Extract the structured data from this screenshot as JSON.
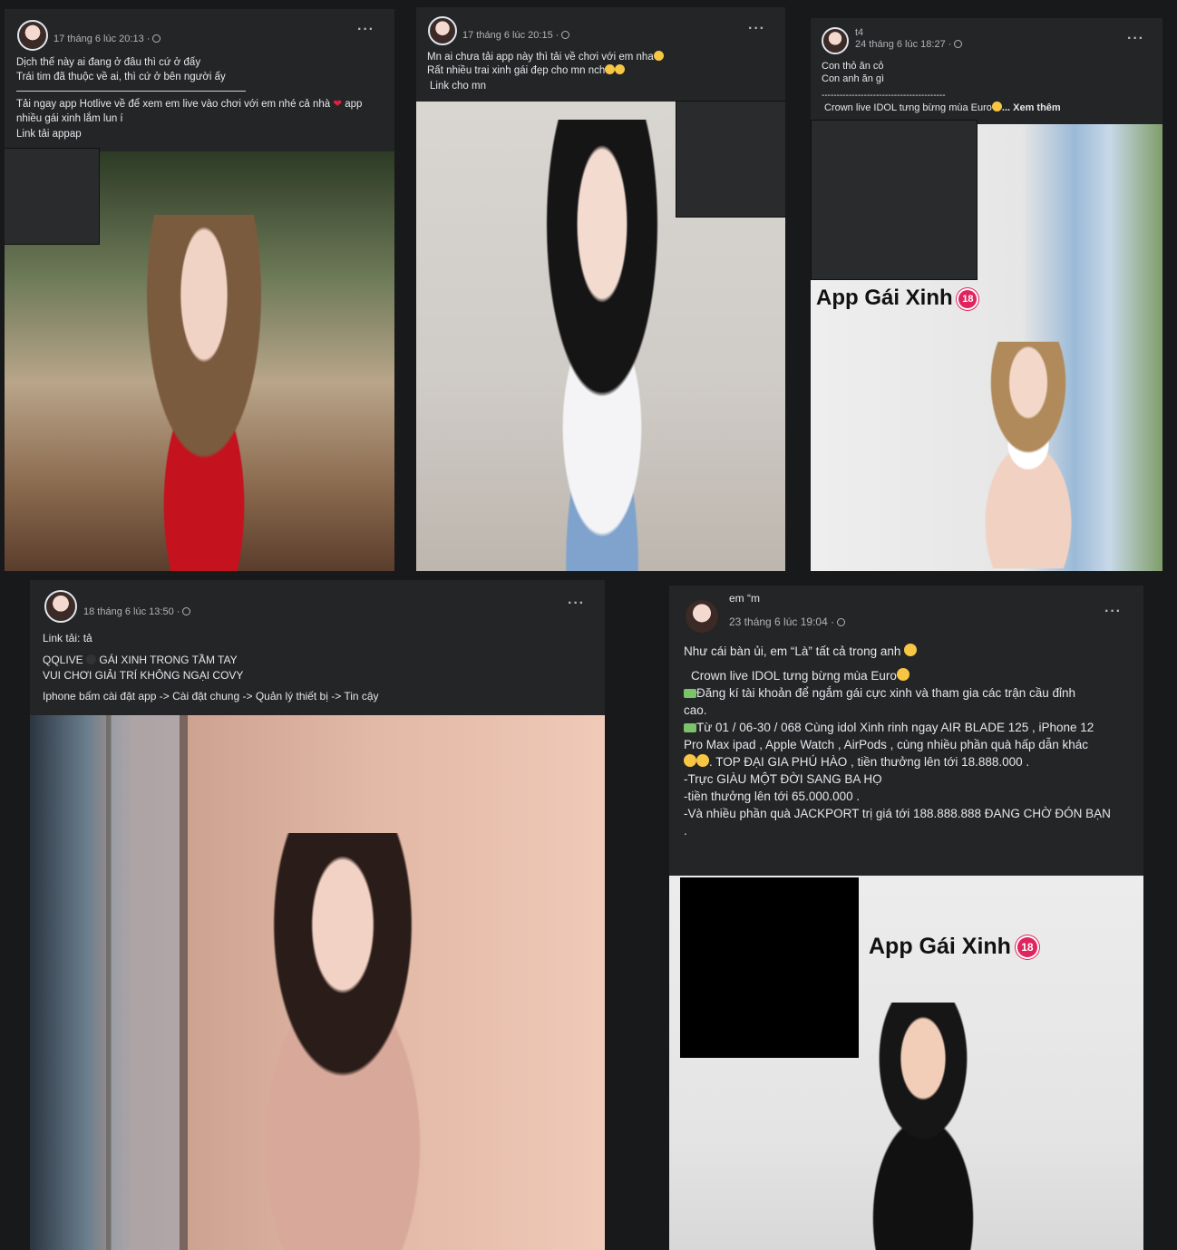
{
  "posts": [
    {
      "meta": "17 tháng 6 lúc 20:13 ·",
      "text1": "Dịch thế này ai đang ở đâu thì cứ ở đấy\nTrái tim đã thuộc về ai, thì cứ ở bên người ấy",
      "text2a": "Tải ngay app Hotlive về để xem em live vào chơi với em nhé cả nhà ",
      "text2b": " app\nnhiều gái xinh lắm lun í",
      "text3": "Link tải appap"
    },
    {
      "meta": "17 tháng 6 lúc 20:15 ·",
      "text1": "Mn ai chưa tải app này thì tải về chơi với em nha",
      "text2": "Rất nhiều trai xinh gái đẹp cho mn nch",
      "text3": "Link cho mn"
    },
    {
      "name": "t4",
      "meta": "24 tháng 6 lúc 18:27 ·",
      "text1": "Con thỏ ăn cỏ\nCon anh ăn gì",
      "sep": "-----------------------------------------",
      "text2": "Crown live IDOL tưng bừng mùa Euro",
      "more": "... Xem thêm",
      "overlay": "App Gái Xinh",
      "badge": "18"
    },
    {
      "meta": "18 tháng 6 lúc 13:50 ·",
      "text1": "Link tải: tả",
      "text2a": "QQLIVE ",
      "text2b": " GÁI XINH TRONG TẦM TAY\nVUI CHƠI GIẢI TRÍ KHÔNG NGẠI COVY",
      "text3": "Iphone bấm cài đặt app -> Cài đặt chung -> Quản lý thiết bị -> Tin cậy"
    },
    {
      "name": "em “m",
      "meta": "23 tháng 6 lúc 19:04 ·",
      "l1": "Như cái bàn ủi, em “Là” tất cả trong anh",
      "l2": "Crown live IDOL tưng bừng mùa Euro",
      "l3": "Đăng kí tài khoản để ngắm gái cực xinh và tham gia các trận cầu đỉnh\ncao.",
      "l4": "Từ 01 / 06-30 / 068 Cùng idol Xinh rinh ngay AIR BLADE 125 , iPhone 12\nPro Max ipad , Apple Watch , AirPods , cùng nhiều phần quà hấp dẫn khác",
      "l5": ". TOP ĐẠI GIA PHÚ HÀO , tiền thưởng lên tới 18.888.000 .",
      "l6": "-Trực GIÀU MỘT ĐỜI SANG BA HỌ\n-tiền thưởng lên tới 65.000.000 .\n-Và nhiều phần quà JACKPORT trị giá tới 188.888.888 ĐANG CHỜ ĐÓN BẠN\n.",
      "overlay": "App Gái Xinh",
      "badge": "18"
    }
  ],
  "icons": {
    "more": "more-options-icon",
    "globe": "globe-icon",
    "heart": "heart-icon"
  }
}
